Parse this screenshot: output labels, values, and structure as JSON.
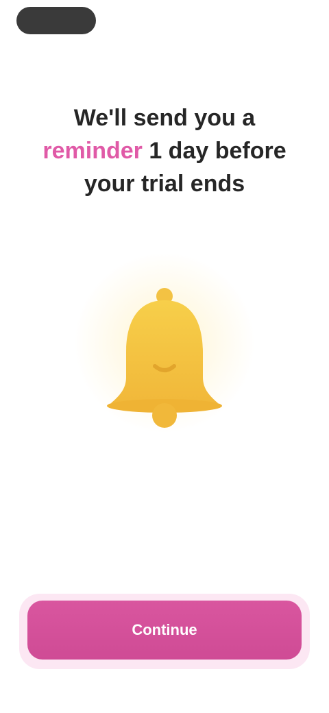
{
  "nav": {
    "back_label": ""
  },
  "headline": {
    "line1": "We'll send you a",
    "accent": "reminder",
    "line2_rest": " 1 day before",
    "line3": "your trial ends"
  },
  "illustration": {
    "icon": "bell-icon",
    "color": "#f5c542"
  },
  "cta": {
    "label": "Continue"
  },
  "colors": {
    "accent": "#e05aa7",
    "button": "#d6529b",
    "text": "#262626"
  }
}
